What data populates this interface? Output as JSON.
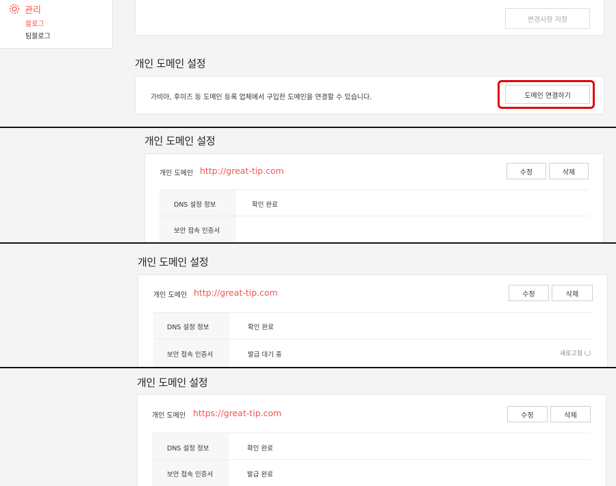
{
  "sidebar": {
    "section_label": "관리",
    "items": [
      {
        "label": "블로그",
        "active": true
      },
      {
        "label": "팀블로그",
        "active": false
      }
    ],
    "accent_color": "#f0544f"
  },
  "panel1": {
    "save_button_label": "변경사항 저장",
    "section_title": "개인 도메인 설정",
    "description": "가비아, 후이즈 등 도메인 등록 업체에서 구입한 도메인을 연결할 수 있습니다.",
    "connect_button_label": "도메인 연결하기"
  },
  "panel2": {
    "section_title": "개인 도메인 설정",
    "domain_label": "개인 도메인",
    "domain_value": "http://great-tip.com",
    "edit_label": "수정",
    "delete_label": "삭제",
    "rows": [
      {
        "key": "DNS 설정 정보",
        "value": "확인 완료"
      },
      {
        "key": "보안 접속 인증서",
        "value": ""
      }
    ]
  },
  "panel3": {
    "section_title": "개인 도메인 설정",
    "domain_label": "개인 도메인",
    "domain_value": "http://great-tip.com",
    "edit_label": "수정",
    "delete_label": "삭제",
    "rows": [
      {
        "key": "DNS 설정 정보",
        "value": "확인 완료"
      },
      {
        "key": "보안 접속 인증서",
        "value": "발급 대기 중"
      }
    ],
    "refresh_label": "새로고침"
  },
  "panel4": {
    "section_title": "개인 도메인 설정",
    "domain_label": "개인 도메인",
    "domain_value": "https://great-tip.com",
    "edit_label": "수정",
    "delete_label": "삭제",
    "rows": [
      {
        "key": "DNS 설정 정보",
        "value": "확인 완료"
      },
      {
        "key": "보안 접속 인증서",
        "value": "발급 완료"
      }
    ]
  }
}
